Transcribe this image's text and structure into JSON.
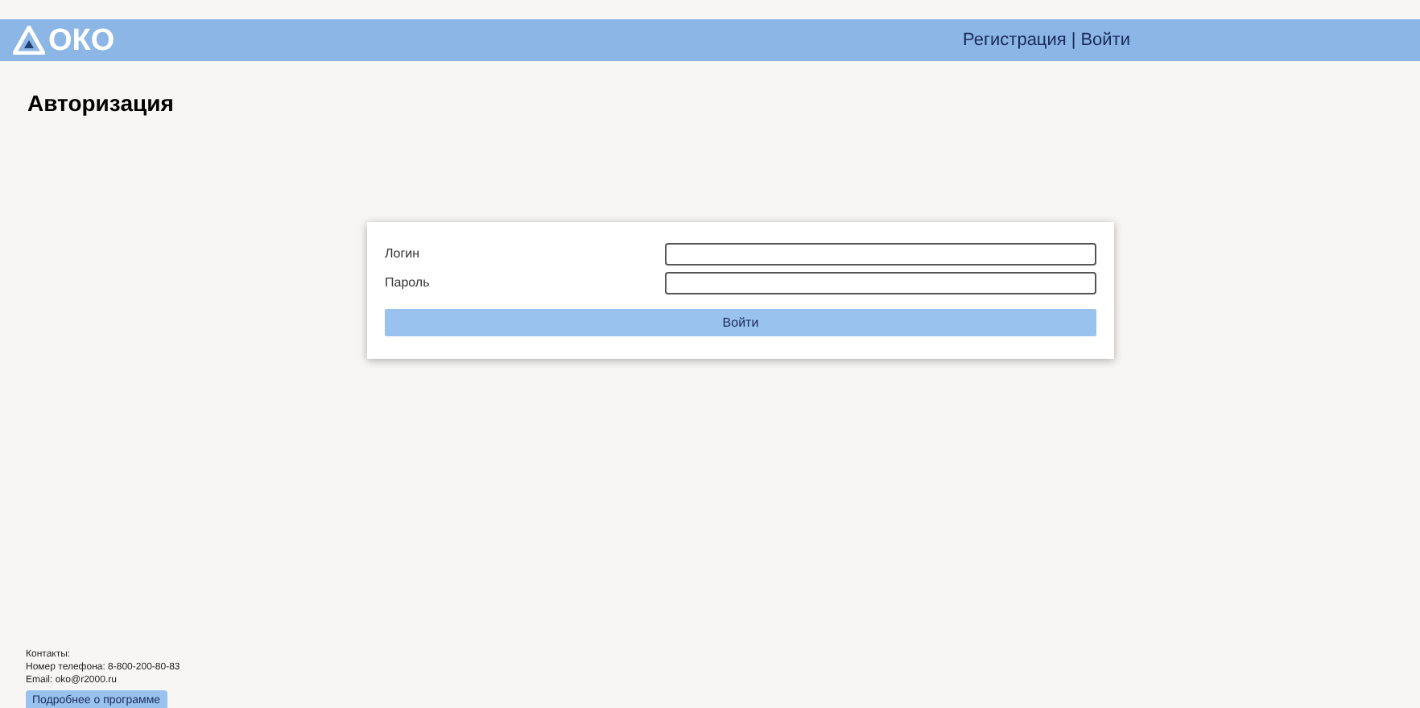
{
  "header": {
    "logo": "ОКО",
    "links": [
      "Регистрация",
      "Войти"
    ],
    "separator": "|"
  },
  "title": "Авторизация",
  "form": {
    "fields": [
      {
        "label": "Логин"
      },
      {
        "label": "Пароль"
      }
    ],
    "submit": "Войти"
  },
  "footer": {
    "lines": [
      "Контакты:",
      "Номер телефона: 8-800-200-80-83",
      "Email: oko@r2000.ru"
    ],
    "button": "Подробнее о программе"
  }
}
